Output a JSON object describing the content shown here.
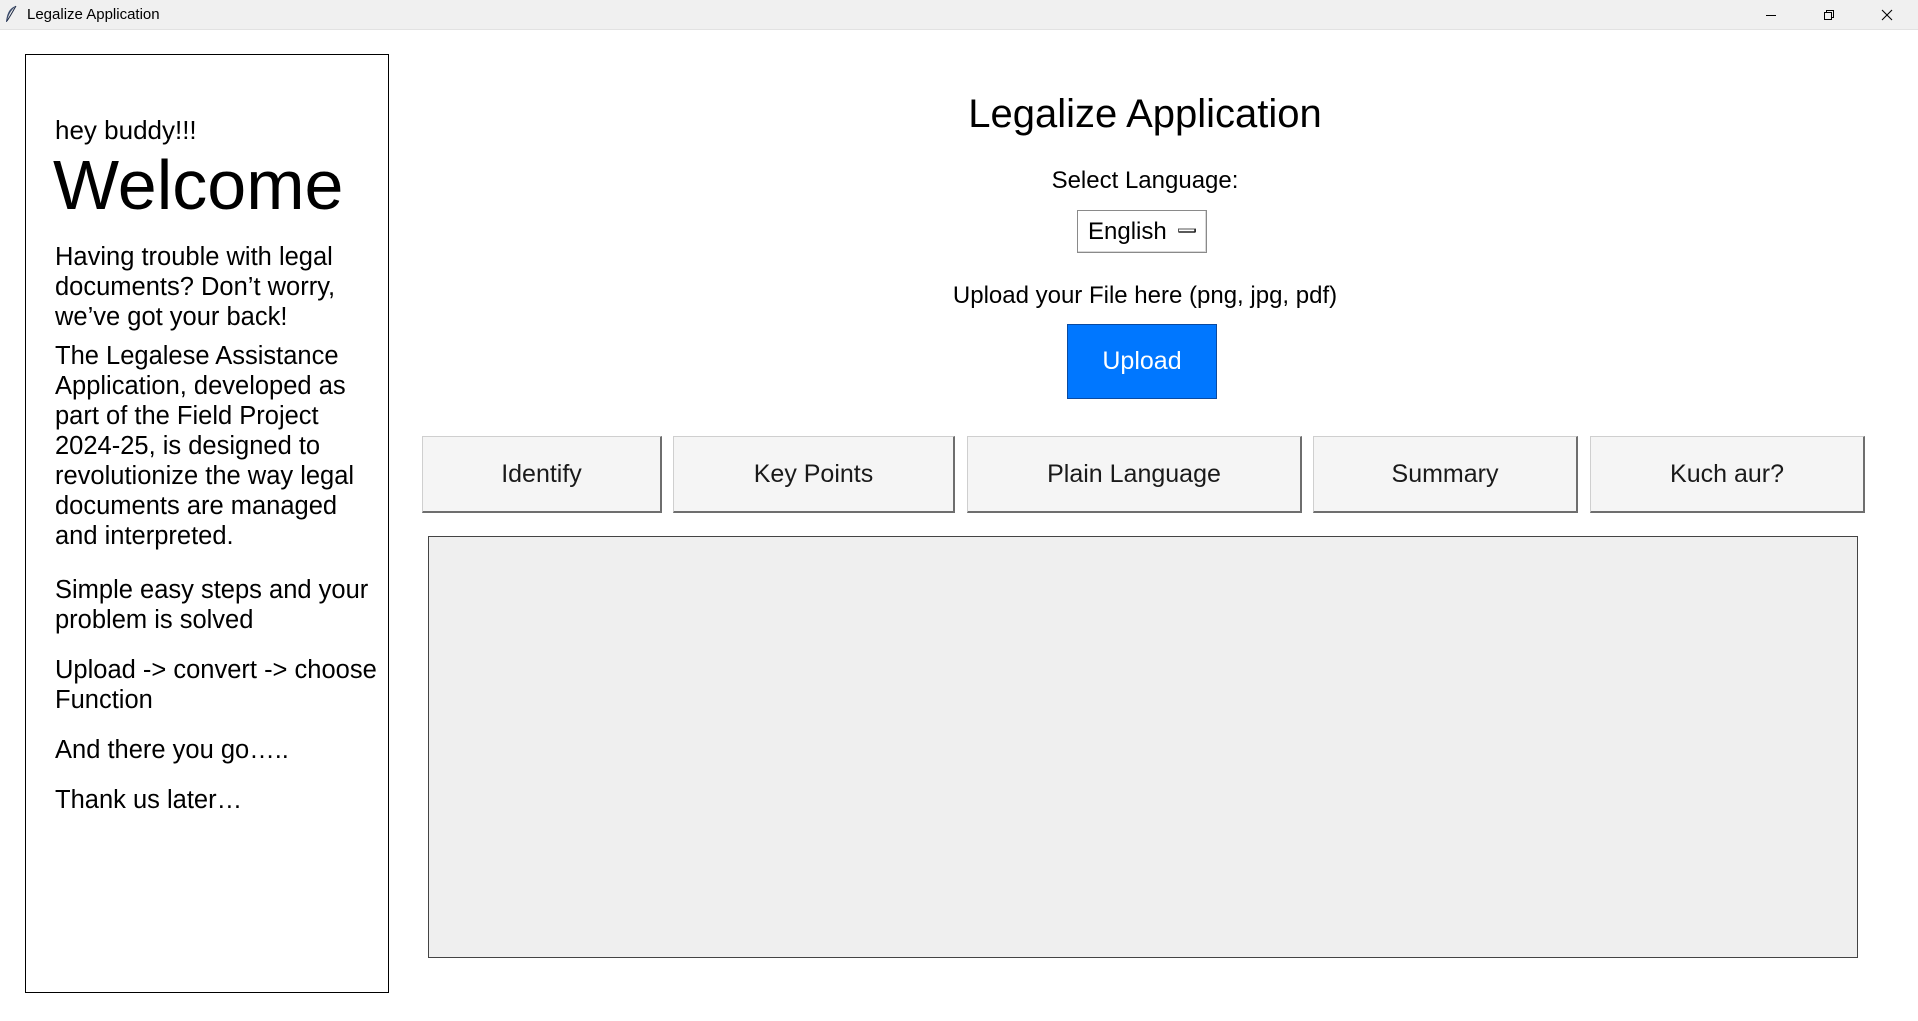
{
  "window": {
    "title": "Legalize Application",
    "controls": {
      "minimize_icon": "minimize-icon",
      "maximize_icon": "restore-icon",
      "close_icon": "close-icon"
    }
  },
  "sidebar": {
    "greeting": "hey buddy!!!",
    "welcome": "Welcome",
    "paragraphs": [
      "Having trouble with legal documents? Don’t worry, we’ve got your back!",
      "The Legalese Assistance Application, developed as part of the Field Project 2024-25, is designed to revolutionize the way legal documents are managed and interpreted.",
      "Simple easy steps and your problem is solved",
      "Upload -> convert -> choose Function",
      "And there you go…..",
      "Thank us later…"
    ]
  },
  "main": {
    "title": "Legalize Application",
    "language": {
      "label": "Select Language:",
      "selected": "English"
    },
    "upload": {
      "label": "Upload your File here (png, jpg, pdf)",
      "button_label": "Upload",
      "button_color": "#0077ff"
    },
    "functions": [
      "Identify",
      "Key Points",
      "Plain Language",
      "Summary",
      "Kuch aur?"
    ],
    "output_text": ""
  }
}
